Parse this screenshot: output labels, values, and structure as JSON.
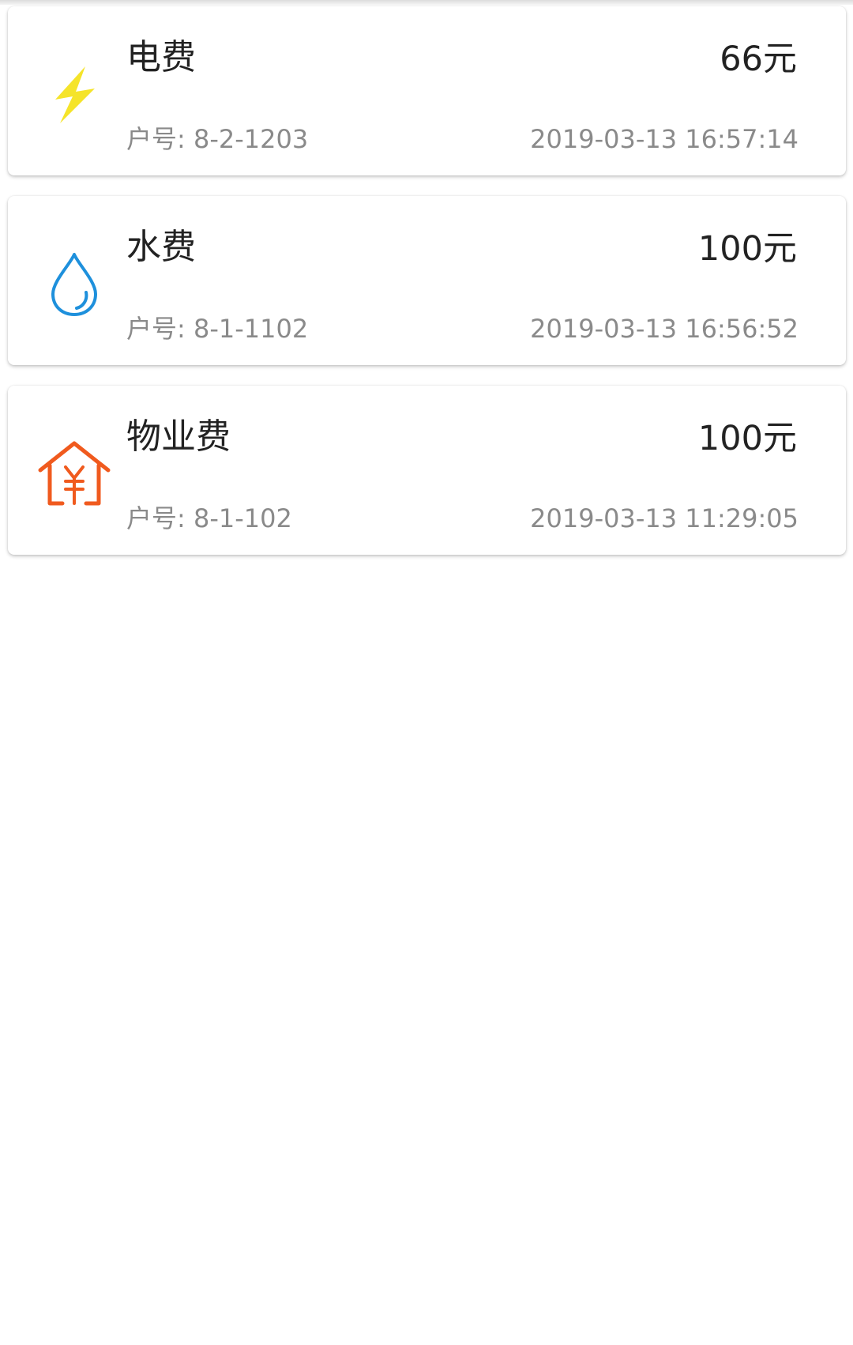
{
  "payments": [
    {
      "icon": "lightning-icon",
      "icon_color": "#F5E42A",
      "title": "电费",
      "amount": "66元",
      "account_label": "户号:",
      "account": "8-2-1203",
      "time": "2019-03-13 16:57:14"
    },
    {
      "icon": "water-drop-icon",
      "icon_color": "#1E90DC",
      "title": "水费",
      "amount": "100元",
      "account_label": "户号:",
      "account": "8-1-1102",
      "time": "2019-03-13 16:56:52"
    },
    {
      "icon": "house-yen-icon",
      "icon_color": "#F05A1E",
      "title": "物业费",
      "amount": "100元",
      "account_label": "户号:",
      "account": "8-1-102",
      "time": "2019-03-13 11:29:05"
    }
  ]
}
